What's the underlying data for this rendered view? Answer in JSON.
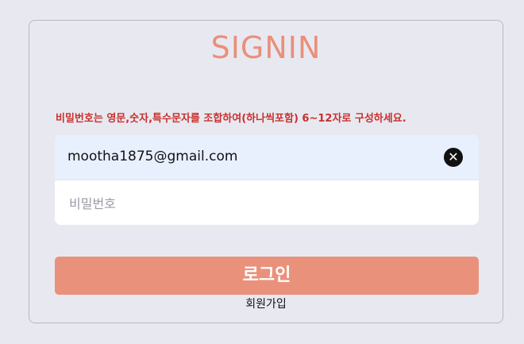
{
  "title": "SIGNIN",
  "error_message": "비밀번호는 영문,숫자,특수문자를 조합하여(하나씩포함) 6~12자로 구성하세요.",
  "email": {
    "value": "mootha1875@gmail.com",
    "clear_icon": "close-icon"
  },
  "password": {
    "placeholder": "비밀번호",
    "value": ""
  },
  "login_label": "로그인",
  "signup_label": "회원가입",
  "colors": {
    "accent": "#ea917c",
    "error": "#c9302c",
    "background": "#e8e9f0",
    "autofill": "#e8f0fe"
  }
}
